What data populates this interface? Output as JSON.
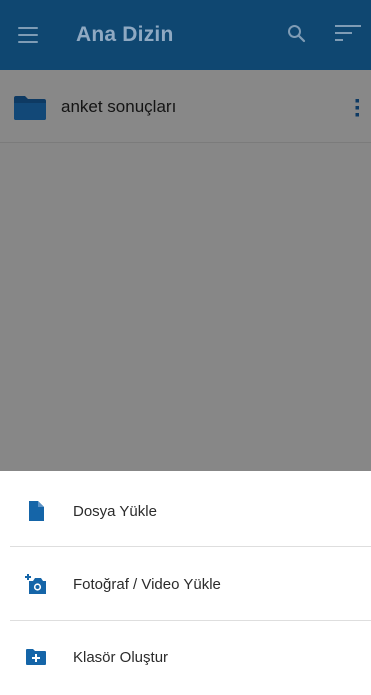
{
  "app": {
    "title": "Ana Dizin",
    "colors": {
      "toolbar": "#0f4771",
      "accent": "#1565a8",
      "scrim": "#878787"
    },
    "toolbar_icons": [
      "menu-icon",
      "search-icon",
      "sort-icon"
    ]
  },
  "files": [
    {
      "name": "anket sonuçları",
      "type": "folder",
      "icon": "folder-icon"
    }
  ],
  "bottom_sheet": {
    "items": [
      {
        "label": "Dosya Yükle",
        "icon": "file-upload-icon"
      },
      {
        "label": "Fotoğraf / Video Yükle",
        "icon": "add-camera-icon"
      },
      {
        "label": "Klasör Oluştur",
        "icon": "create-folder-icon"
      }
    ]
  }
}
